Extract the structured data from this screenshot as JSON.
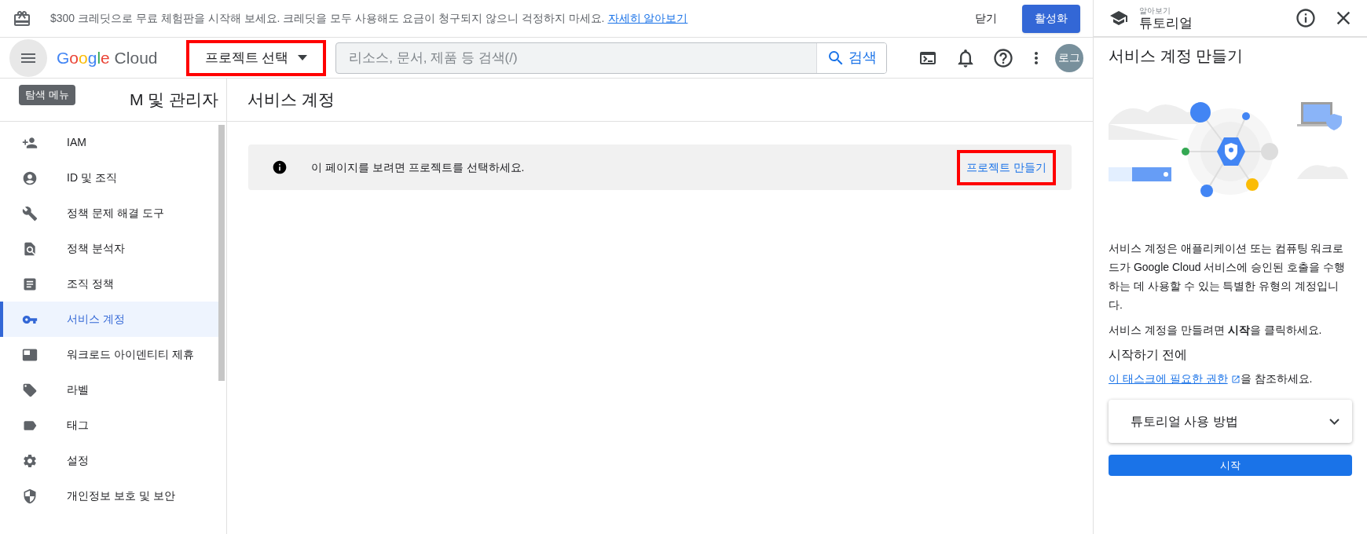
{
  "banner": {
    "text": "$300 크레딧으로 무료 체험판을 시작해 보세요. 크레딧을 모두 사용해도 요금이 청구되지 않으니 걱정하지 마세요.",
    "link": "자세히 알아보기",
    "dismiss": "닫기",
    "activate": "활성화"
  },
  "header": {
    "tooltip": "탐색 메뉴",
    "logo": "Google Cloud",
    "project_picker": {
      "label": "프로젝트 선택",
      "highlighted": true
    },
    "search": {
      "placeholder": "리소스, 문서, 제품 등 검색(/)",
      "button": "검색"
    },
    "avatar": "로그"
  },
  "sidebar": {
    "title": "M 및 관리자",
    "items": [
      {
        "label": "IAM",
        "selected": false
      },
      {
        "label": "ID 및 조직",
        "selected": false
      },
      {
        "label": "정책 문제 해결 도구",
        "selected": false
      },
      {
        "label": "정책 분석자",
        "selected": false
      },
      {
        "label": "조직 정책",
        "selected": false
      },
      {
        "label": "서비스 계정",
        "selected": true
      },
      {
        "label": "워크로드 아이덴티티 제휴",
        "selected": false
      },
      {
        "label": "라벨",
        "selected": false
      },
      {
        "label": "태그",
        "selected": false
      },
      {
        "label": "설정",
        "selected": false
      },
      {
        "label": "개인정보 보호 및 보안",
        "selected": false
      }
    ]
  },
  "main": {
    "title": "서비스 계정",
    "notice": {
      "text": "이 페이지를 보려면 프로젝트를 선택하세요.",
      "action": {
        "label": "프로젝트 만들기",
        "highlighted": true
      }
    }
  },
  "tutorial": {
    "eyebrow": "알아보기",
    "title": "튜토리얼",
    "heading": "서비스 계정 만들기",
    "paragraphs": [
      "서비스 계정은 애플리케이션 또는 컴퓨팅 워크로드가 Google Cloud 서비스에 승인된 호출을 수행하는 데 사용할 수 있는 특별한 유형의 계정입니다.",
      "서비스 계정을 만들려면 **시작**을 클릭하세요."
    ],
    "subheading": "시작하기 전에",
    "reference": {
      "link": "이 태스크에 필요한 권한",
      "rest": "을 참조하세요."
    },
    "accordion": {
      "label": "튜토리얼 사용 방법",
      "expanded": false
    },
    "start": "시작"
  }
}
